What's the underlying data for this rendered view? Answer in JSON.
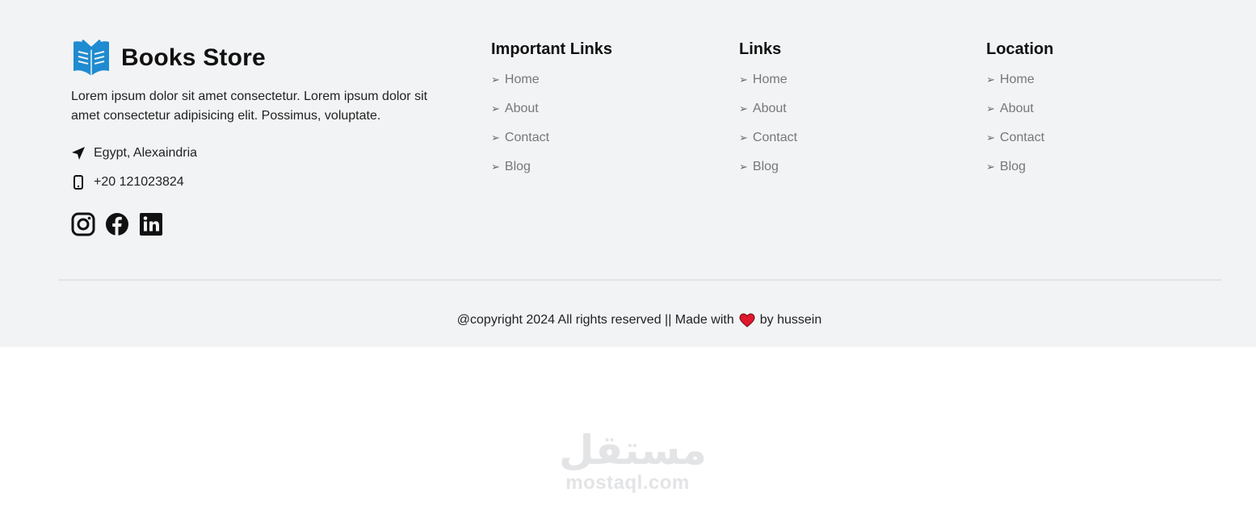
{
  "brand": {
    "name": "Books Store",
    "logo_icon": "open-book-icon",
    "logo_color": "#1f8bd0"
  },
  "about": {
    "text": "Lorem ipsum dolor sit amet consectetur. Lorem ipsum dolor sit amet consectetur adipisicing elit. Possimus, voluptate."
  },
  "contact": {
    "location": "Egypt, Alexaindria",
    "location_icon": "location-arrow-icon",
    "phone": "+20 121023824",
    "phone_icon": "mobile-phone-icon"
  },
  "socials": [
    {
      "name": "instagram-icon"
    },
    {
      "name": "facebook-icon"
    },
    {
      "name": "linkedin-icon"
    }
  ],
  "columns": [
    {
      "title": "Important Links",
      "items": [
        "Home",
        "About",
        "Contact",
        "Blog"
      ]
    },
    {
      "title": "Links",
      "items": [
        "Home",
        "About",
        "Contact",
        "Blog"
      ]
    },
    {
      "title": "Location",
      "items": [
        "Home",
        "About",
        "Contact",
        "Blog"
      ]
    }
  ],
  "link_arrow": "➢",
  "footer": {
    "copyright_before": "@copyright 2024 All rights reserved || Made with",
    "copyright_after": "by hussein",
    "heart_icon": "heart-icon",
    "heart_color": "#e0182d"
  },
  "watermark": {
    "arabic": "مستقل",
    "latin": "mostaql.com"
  },
  "colors": {
    "footer_bg": "#f2f3f5",
    "link_text": "#777777",
    "heading_text": "#111111"
  }
}
